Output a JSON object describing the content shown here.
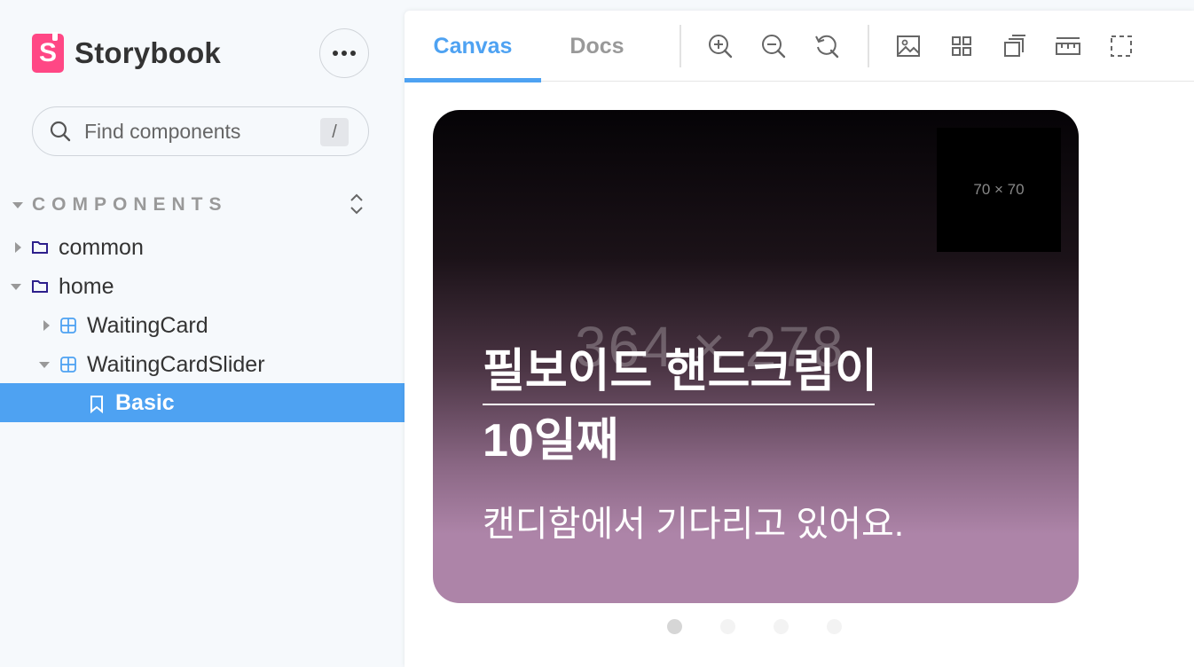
{
  "sidebar": {
    "brand": {
      "logo_letter": "S",
      "name": "Storybook"
    },
    "menu_button": "more-options",
    "search": {
      "placeholder": "Find components",
      "shortcut": "/"
    },
    "section": {
      "title": "COMPONENTS"
    },
    "tree": [
      {
        "label": "common",
        "type": "folder",
        "expanded": false,
        "level": 0
      },
      {
        "label": "home",
        "type": "folder",
        "expanded": true,
        "level": 0
      },
      {
        "label": "WaitingCard",
        "type": "component",
        "expanded": false,
        "level": 1
      },
      {
        "label": "WaitingCardSlider",
        "type": "component",
        "expanded": true,
        "level": 1
      },
      {
        "label": "Basic",
        "type": "story",
        "selected": true,
        "level": 2
      }
    ]
  },
  "toolbar": {
    "tabs": [
      {
        "label": "Canvas",
        "active": true
      },
      {
        "label": "Docs",
        "active": false
      }
    ],
    "tools": [
      "zoom-in-icon",
      "zoom-out-icon",
      "reset-zoom-icon",
      "background-icon",
      "grid-icon",
      "viewport-icon",
      "measure-icon",
      "outline-icon"
    ]
  },
  "card": {
    "placeholder_image": "70 × 70",
    "background_placeholder": "364 × 278",
    "title_line1": "필보이드 핸드크림이",
    "title_line2": "10일째",
    "subtitle": "캔디함에서 기다리고 있어요.",
    "gradient_top": "#050306",
    "gradient_bottom": "#ad84a8"
  },
  "pagination": {
    "count": 4,
    "active_index": 0
  },
  "colors": {
    "accent": "#4ea2f2",
    "brand": "#ff4785"
  }
}
